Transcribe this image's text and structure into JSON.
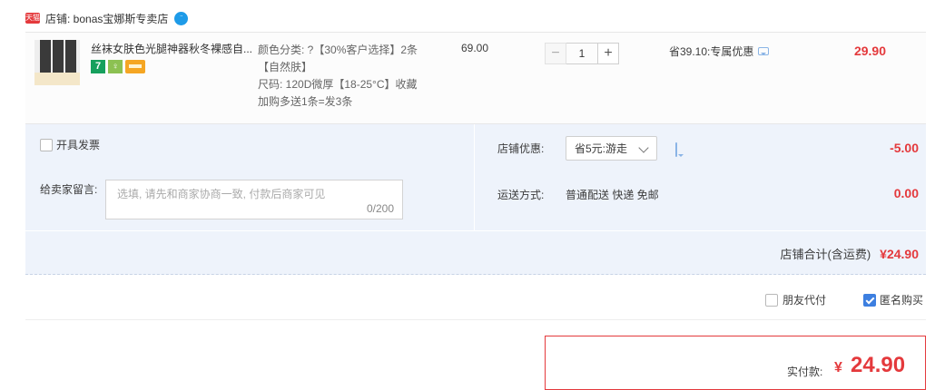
{
  "shop": {
    "badge_text": "天猫",
    "label": "店铺: bonas宝娜斯专卖店",
    "chat_icon": "wangwang-chat-icon"
  },
  "item": {
    "title": "丝袜女肤色光腿神器秋冬裸感自...",
    "sku_color": "颜色分类: ?【30%客户选择】2条【自然肤】",
    "sku_size": "尺码: 120D微厚【18-25°C】收藏加购多送1条=发3条",
    "price": "69.00",
    "qty_minus": "−",
    "qty": "1",
    "qty_plus": "+",
    "discount": "省39.10:专属优惠",
    "subtotal": "29.90",
    "badge_7": "7",
    "badge_g": "♀"
  },
  "extras": {
    "invoice_label": "开具发票",
    "message_label": "给卖家留言:",
    "message_placeholder": "选填, 请先和商家协商一致, 付款后商家可见",
    "message_count": "0/200",
    "coupon_label": "店铺优惠:",
    "coupon_value": "省5元:游走",
    "coupon_amount": "-5.00",
    "shipping_label": "运送方式:",
    "shipping_value": "普通配送 快递 免邮",
    "shipping_amount": "0.00",
    "shop_total_label": "店铺合计(含运费)",
    "shop_total_value": "¥24.90"
  },
  "options": {
    "friend_pay_label": "朋友代付",
    "anonymous_label": "匿名购买",
    "anonymous_checked": true
  },
  "payment": {
    "label": "实付款:",
    "currency": "¥",
    "amount": "24.90"
  },
  "colors": {
    "accent_red": "#e4393c",
    "panel_blue": "#eef3fb",
    "check_blue": "#3d7fe0"
  }
}
